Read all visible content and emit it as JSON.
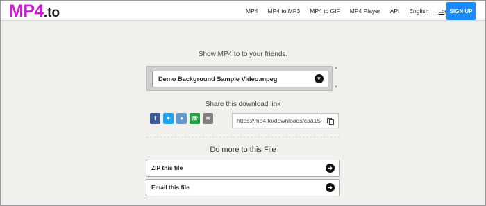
{
  "brand": {
    "name": "MP4",
    "ext": ".to"
  },
  "nav": {
    "links": [
      "MP4",
      "MP4 to MP3",
      "MP4 to GIF",
      "MP4 Player",
      "API",
      "English"
    ],
    "login": "Login",
    "signup": "SIGN UP"
  },
  "main": {
    "headline": "Show MP4.to to your friends.",
    "file_name": "Demo Background Sample Video.mpeg",
    "share_title": "Share this download link",
    "share_icons": [
      "facebook-icon",
      "twitter-icon",
      "reddit-icon",
      "whatsapp-icon",
      "email-icon"
    ],
    "download_link": "https://mp4.to/downloads/caa1S",
    "more_title": "Do more to this File",
    "actions": [
      "ZIP this file",
      "Email this file"
    ]
  },
  "colors": {
    "brand": "#d11ad9",
    "signup_bg": "#1a8cff",
    "background": "#f1f0ec"
  }
}
